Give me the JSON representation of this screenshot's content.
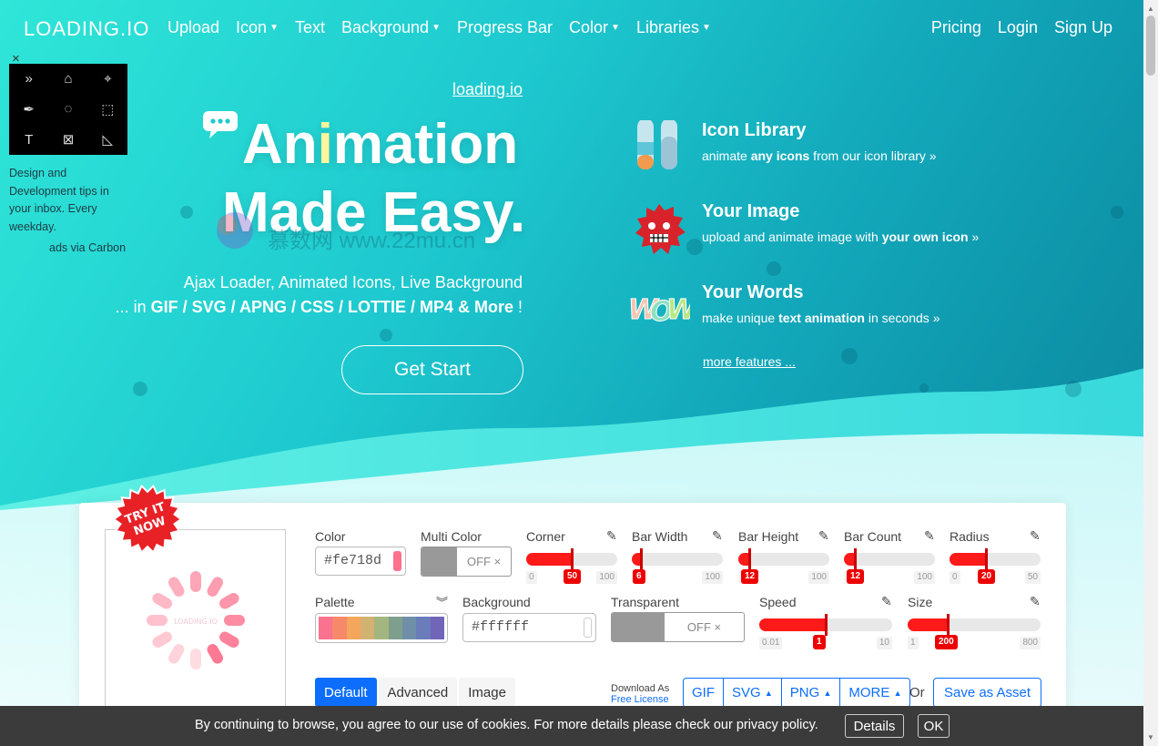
{
  "nav": {
    "brand": "LOADING.IO",
    "left": [
      {
        "label": "Upload",
        "dropdown": false
      },
      {
        "label": "Icon",
        "dropdown": true
      },
      {
        "label": "Text",
        "dropdown": false
      },
      {
        "label": "Background",
        "dropdown": true
      },
      {
        "label": "Progress Bar",
        "dropdown": false
      },
      {
        "label": "Color",
        "dropdown": true
      },
      {
        "label": "Libraries",
        "dropdown": true
      }
    ],
    "right": [
      "Pricing",
      "Login",
      "Sign Up"
    ]
  },
  "ad": {
    "close": "×",
    "text": "Design and Development tips in your inbox. Every weekday.",
    "via": "ads via Carbon"
  },
  "hero": {
    "logo_link": "loading.io",
    "title_a": "An",
    "title_i": "i",
    "title_b": "mation",
    "title_line2": "Made Easy.",
    "subtitle1": "Ajax Loader, Animated Icons, Live Background",
    "subtitle2_prefix": "... in ",
    "subtitle2_formats": "GIF / SVG / APNG / CSS / LOTTIE / MP4 & More",
    "subtitle2_suffix": " !",
    "cta": "Get Start"
  },
  "features": [
    {
      "title": "Icon Library",
      "desc_a": "animate ",
      "desc_b": "any icons",
      "desc_c": " from our icon library",
      "chevron": "»"
    },
    {
      "title": "Your Image",
      "desc_a": "upload and animate image with ",
      "desc_b": "your own icon",
      "desc_c": "",
      "chevron": "»"
    },
    {
      "title": "Your Words",
      "desc_a": "make unique ",
      "desc_b": "text animation",
      "desc_c": " in seconds",
      "chevron": "»"
    }
  ],
  "more_features": "more features ...",
  "watermark": "慕数网 www.22mu.cn",
  "badge": "TRY IT NOW",
  "preview_text": "LOADING.IO",
  "controls": {
    "color": {
      "label": "Color",
      "value": "#fe718d",
      "swatch": "#fe718d"
    },
    "multi_color": {
      "label": "Multi Color",
      "state": "OFF ×"
    },
    "sliders_row1": [
      {
        "label": "Corner",
        "min": "0",
        "max": "100",
        "value": "50",
        "fraction": 0.5
      },
      {
        "label": "Bar Width",
        "min": "1",
        "max": "100",
        "value": "6",
        "fraction": 0.1
      },
      {
        "label": "Bar Height",
        "min": "1",
        "max": "100",
        "value": "12",
        "fraction": 0.12
      },
      {
        "label": "Bar Count",
        "min": "2",
        "max": "100",
        "value": "12",
        "fraction": 0.12
      },
      {
        "label": "Radius",
        "min": "0",
        "max": "50",
        "value": "20",
        "fraction": 0.4
      }
    ],
    "palette": {
      "label": "Palette",
      "colors": [
        "#f9728e",
        "#f7896b",
        "#f5a65d",
        "#d2b273",
        "#a4b67f",
        "#7f9f8d",
        "#6f8fa8",
        "#6a7cba",
        "#7065b9"
      ]
    },
    "background": {
      "label": "Background",
      "value": "#ffffff"
    },
    "transparent": {
      "label": "Transparent",
      "state": "OFF ×"
    },
    "sliders_row2": [
      {
        "label": "Speed",
        "min": "0.01",
        "max": "10",
        "value": "1",
        "fraction": 0.5
      },
      {
        "label": "Size",
        "min": "1",
        "max": "800",
        "value": "200",
        "fraction": 0.3
      }
    ]
  },
  "tabs": [
    "Default",
    "Advanced",
    "Image"
  ],
  "download": {
    "label": "Download As",
    "license": "Free License",
    "buttons": [
      {
        "label": "GIF",
        "caret": false
      },
      {
        "label": "SVG",
        "caret": true
      },
      {
        "label": "PNG",
        "caret": true
      },
      {
        "label": "MORE",
        "caret": true
      }
    ],
    "or": "Or",
    "save_asset": "Save as Asset"
  },
  "cookie": {
    "text": "By continuing to browse, you agree to our use of cookies. For more details please check our privacy policy.",
    "details": "Details",
    "ok": "OK"
  },
  "colors": {
    "accent_blue": "#0d6efd",
    "slider_red": "#ff1a1a",
    "spinner_pink": "#fe718d"
  }
}
